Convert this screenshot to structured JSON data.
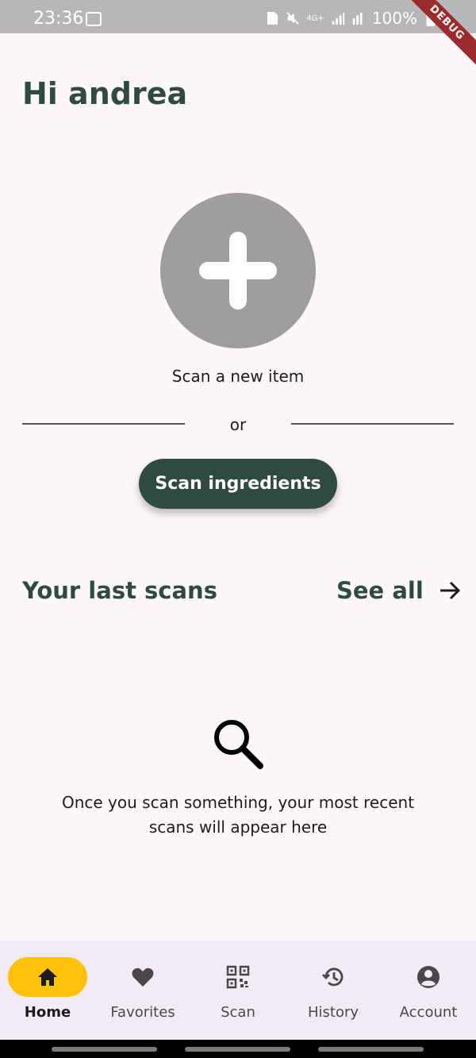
{
  "status_bar": {
    "time": "23:36",
    "battery_percent": "100%",
    "network": "4G+",
    "debug_banner": "DEBUG"
  },
  "greeting": "Hi andrea",
  "scan_new_item": {
    "icon": "plus-icon",
    "label": "Scan a new item"
  },
  "divider_text": "or",
  "scan_ingredients_button": "Scan ingredients",
  "last_scans": {
    "title": "Your last scans",
    "see_all": "See all",
    "empty_message": "Once you scan something, your most recent scans will appear here"
  },
  "bottom_nav": {
    "items": [
      {
        "label": "Home",
        "icon": "home-icon",
        "active": true
      },
      {
        "label": "Favorites",
        "icon": "heart-icon",
        "active": false
      },
      {
        "label": "Scan",
        "icon": "qr-code-icon",
        "active": false
      },
      {
        "label": "History",
        "icon": "history-icon",
        "active": false
      },
      {
        "label": "Account",
        "icon": "account-icon",
        "active": false
      }
    ]
  },
  "colors": {
    "primary": "#2f4a3f",
    "accent": "#ffc107",
    "background": "#fcf7fa",
    "nav_background": "#f2ebf5",
    "add_circle": "#9f9d9f"
  }
}
